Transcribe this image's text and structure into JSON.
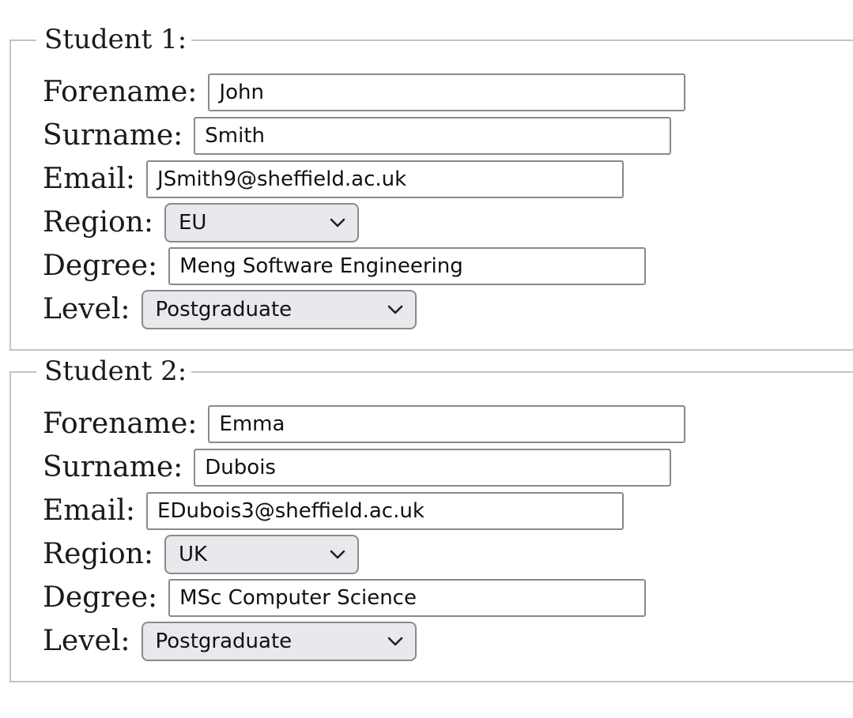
{
  "students": [
    {
      "legend": "Student 1:",
      "forename_label": "Forename:",
      "forename_value": "John",
      "surname_label": "Surname:",
      "surname_value": "Smith",
      "email_label": "Email:",
      "email_value": "JSmith9@sheffield.ac.uk",
      "region_label": "Region:",
      "region_value": "EU",
      "degree_label": "Degree:",
      "degree_value": "Meng Software Engineering",
      "level_label": "Level:",
      "level_value": "Postgraduate"
    },
    {
      "legend": "Student 2:",
      "forename_label": "Forename:",
      "forename_value": "Emma",
      "surname_label": "Surname:",
      "surname_value": "Dubois",
      "email_label": "Email:",
      "email_value": "EDubois3@sheffield.ac.uk",
      "region_label": "Region:",
      "region_value": "UK",
      "degree_label": "Degree:",
      "degree_value": "MSc Computer Science",
      "level_label": "Level:",
      "level_value": "Postgraduate"
    }
  ],
  "icons": {
    "dropdown": "chevron-down-icon"
  },
  "colors": {
    "fieldset_border": "#c4c4c4",
    "input_border": "#8a8a8a",
    "select_background": "#e9e9ed"
  }
}
